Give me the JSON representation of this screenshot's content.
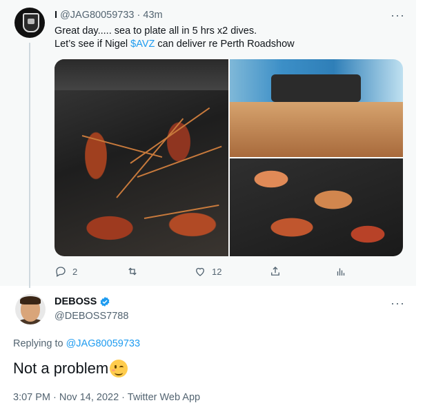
{
  "tweet1": {
    "display_name": "I",
    "handle": "@JAG80059733",
    "time": "· 43m",
    "line1": "Great day..... sea to plate all in 5 hrs x2 dives.",
    "line2_pre": "Let’s see if Nigel ",
    "cashtag": "$AVZ",
    "line2_post": " can deliver re Perth Roadshow",
    "more": "···",
    "replies": "2",
    "retweets": "",
    "likes": "12"
  },
  "tweet2": {
    "display_name": "DEBOSS",
    "handle": "@DEBOSS7788",
    "more": "···",
    "replying_prefix": "Replying to ",
    "replying_to": "@JAG80059733",
    "text": "Not a problem",
    "meta": "3:07 PM · Nov 14, 2022 · Twitter Web App"
  },
  "colors": {
    "link": "#1d9bf0",
    "muted": "#536471",
    "thread_bg": "#f7f9f9"
  },
  "icons": [
    "reply-icon",
    "retweet-icon",
    "like-icon",
    "share-icon",
    "analytics-icon",
    "verified-badge-icon",
    "more-icon"
  ]
}
